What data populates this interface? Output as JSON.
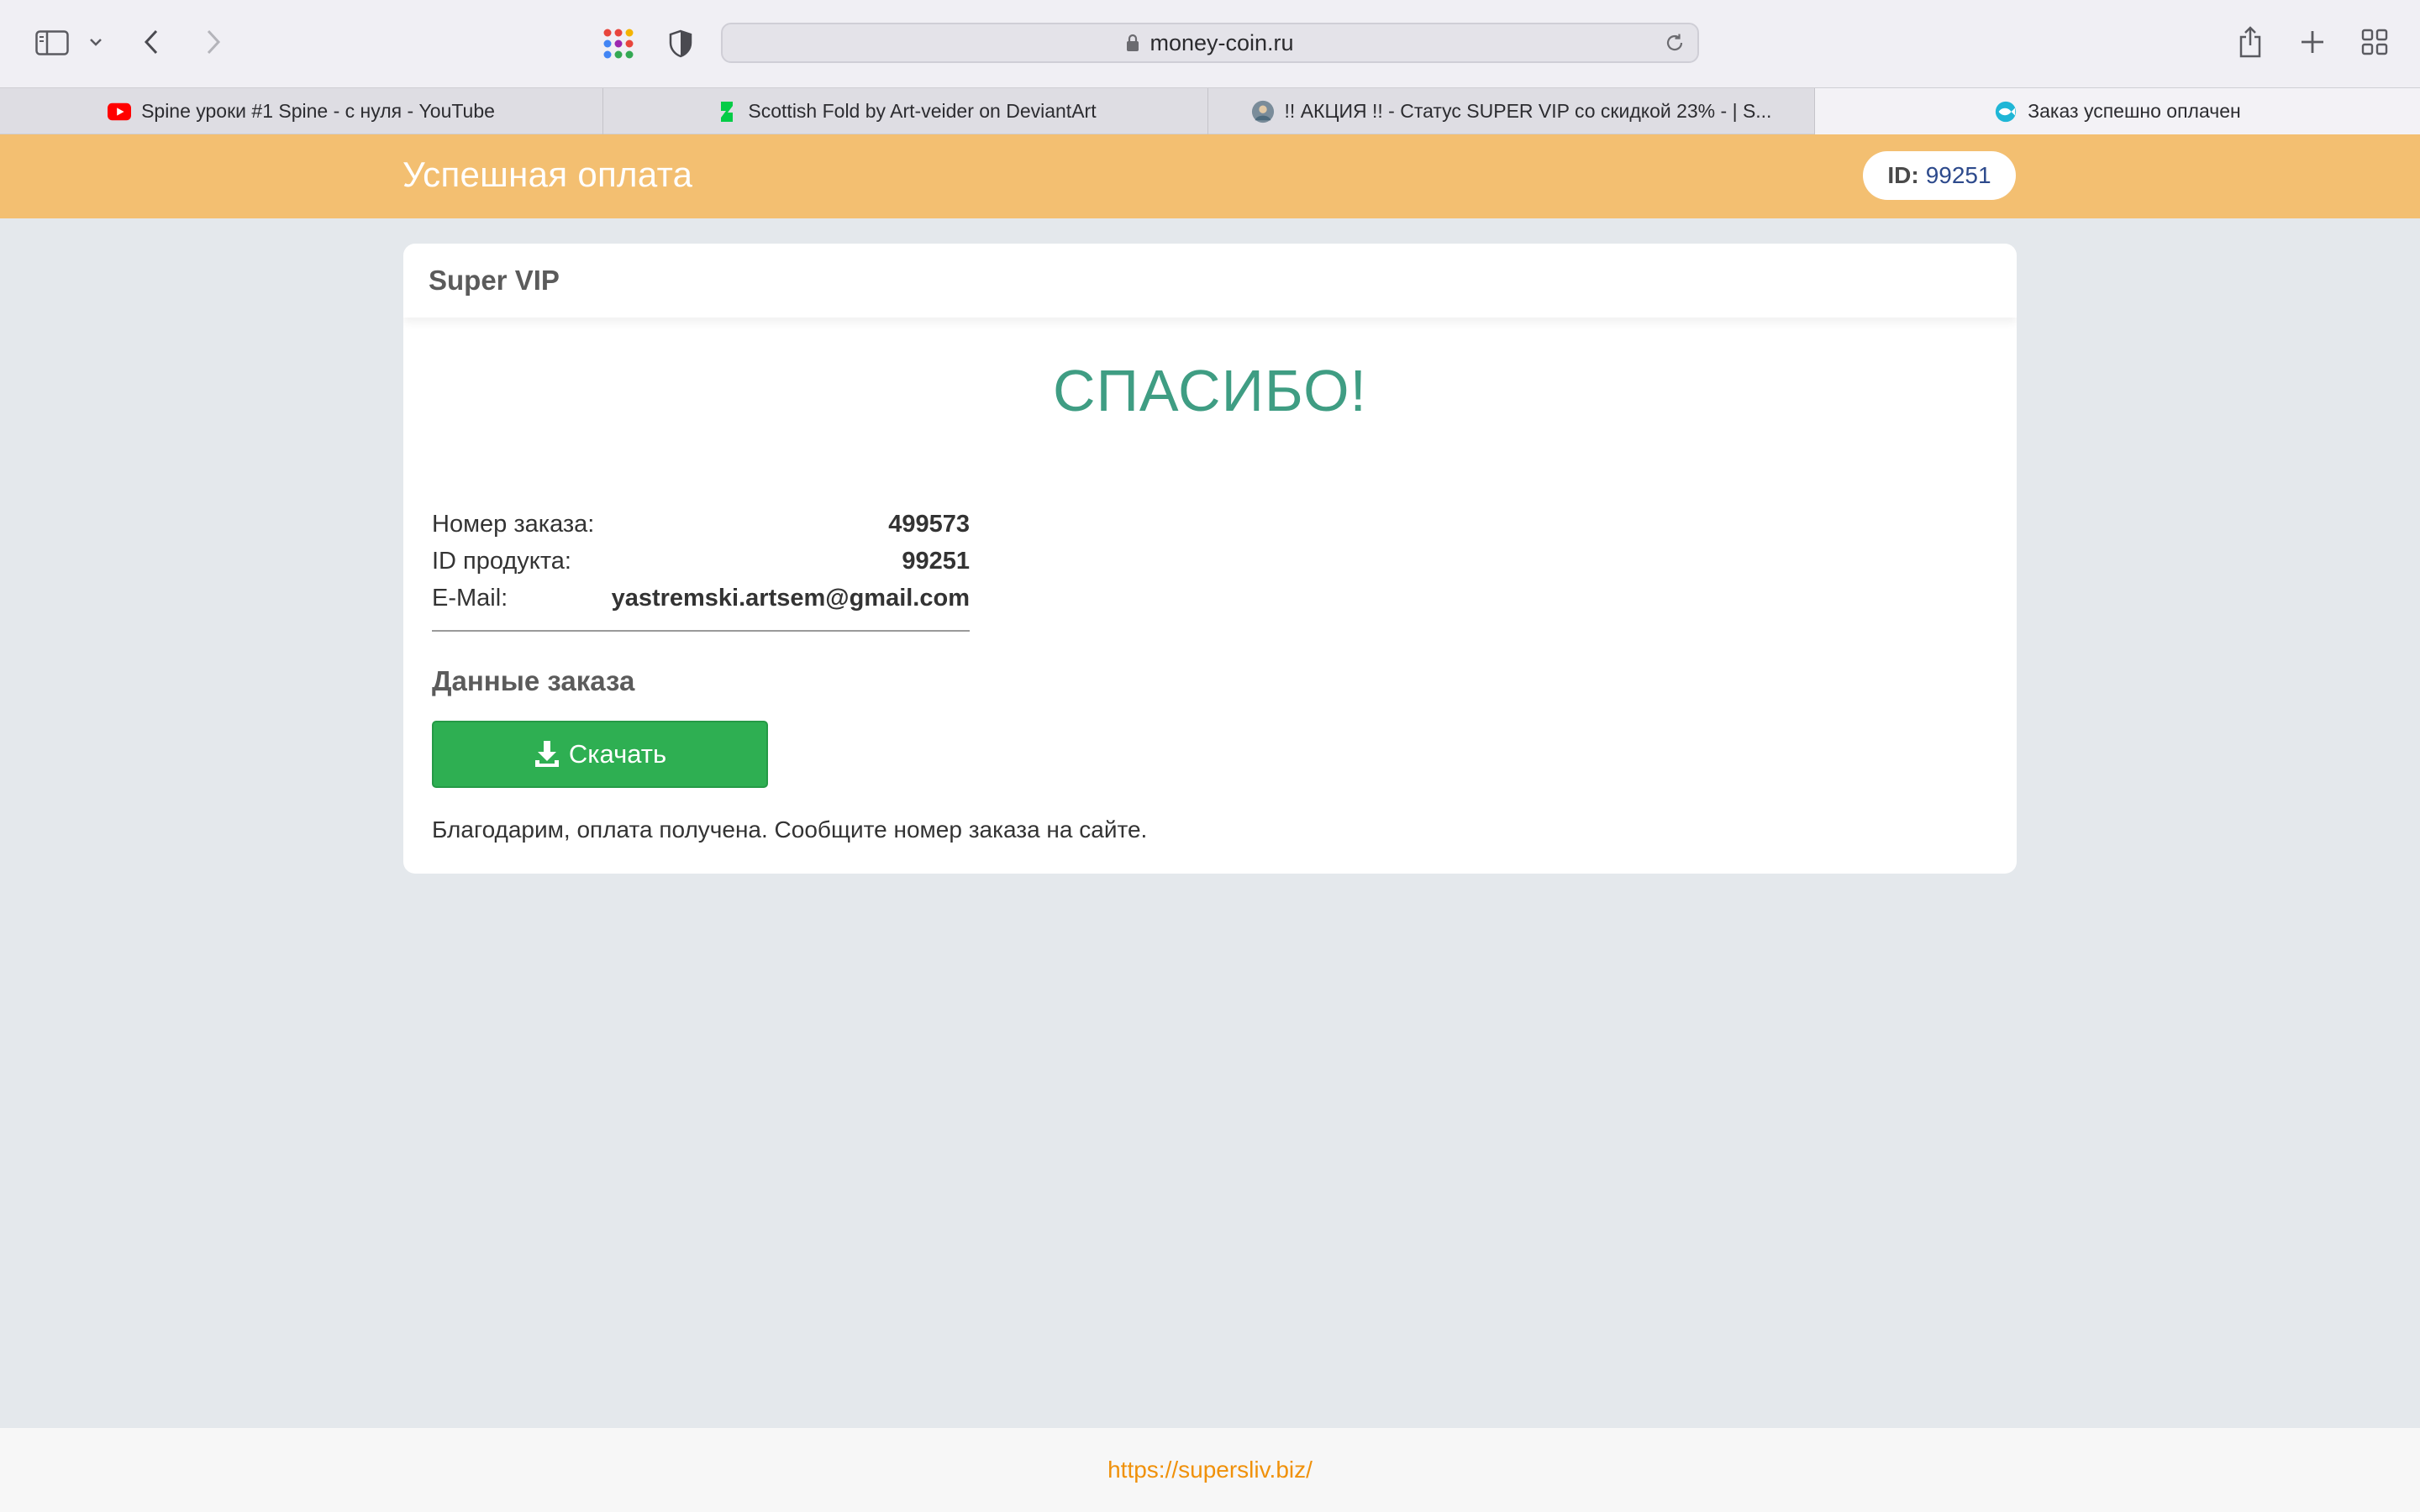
{
  "browser": {
    "address": "money-coin.ru",
    "tabs": [
      {
        "title": "Spine уроки #1 Spine - с нуля - YouTube",
        "favicon": "youtube-icon"
      },
      {
        "title": "Scottish Fold by Art-veider on DeviantArt",
        "favicon": "deviantart-icon"
      },
      {
        "title": "!! АКЦИЯ !! - Статус SUPER VIP со скидкой 23% - | S...",
        "favicon": "site-avatar-icon"
      },
      {
        "title": "Заказ успешно оплачен",
        "favicon": "fish-icon"
      }
    ]
  },
  "header": {
    "title": "Успешная оплата",
    "id_label": "ID:",
    "id_value": "99251"
  },
  "card": {
    "title": "Super VIP",
    "thanks": "СПАСИБО!",
    "rows": [
      {
        "label": "Номер заказа:",
        "value": "499573"
      },
      {
        "label": "ID продукта:",
        "value": "99251"
      },
      {
        "label": "E-Mail:",
        "value": "yastremski.artsem@gmail.com"
      }
    ],
    "section_title": "Данные заказа",
    "download_label": "Скачать",
    "note": "Благодарим, оплата получена. Сообщите номер заказа на сайте."
  },
  "footer": {
    "link": "https://supersliv.biz/"
  },
  "colors": {
    "header_bg": "#f3bf71",
    "thanks_text": "#3f9d83",
    "download_button": "#2eaf52",
    "footer_link": "#f0910a"
  }
}
